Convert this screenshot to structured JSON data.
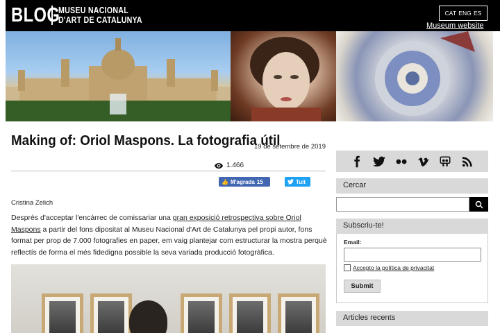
{
  "header": {
    "blog_word": "BLOG",
    "museum_line1": "MUSEU NACIONAL",
    "museum_line2": "D'ART DE CATALUNYA",
    "languages": [
      "CAT",
      "ENG",
      "ES"
    ],
    "museum_link": "Museum website"
  },
  "post": {
    "title": "Making of: Oriol Maspons. La fotografia útil",
    "date": "19 de setembre de 2019",
    "views": "1.466",
    "like_label": "M'agrada",
    "like_count": "15",
    "tweet_label": "Tuit",
    "author": "Cristina Zelich",
    "body_before_link": "Després d'acceptar l'encàrrec de comissariar una ",
    "body_link": "gran exposició retrospectiva sobre Oriol Maspons",
    "body_after_link": " a partir del fons dipositat al Museu Nacional d'Art de Catalunya pel propi autor, fons format per prop de 7.000 fotografies en paper, em vaig plantejar com estructurar la mostra perquè reflectís de forma el més fidedigna possible la seva variada producció fotogràfica."
  },
  "sidebar": {
    "social_icons": [
      "facebook-icon",
      "twitter-icon",
      "flickr-icon",
      "vimeo-icon",
      "slideshare-icon",
      "rss-icon"
    ],
    "search_heading": "Cercar",
    "subscribe_heading": "Subscriu-te!",
    "email_label": "Email:",
    "privacy_label": "Accepto la política de privacitat",
    "submit_label": "Submit",
    "recent_heading": "Articles recents"
  },
  "colors": {
    "facebook": "#4267b2",
    "twitter": "#1da1f2",
    "widget_bg": "#d9d9d9"
  }
}
